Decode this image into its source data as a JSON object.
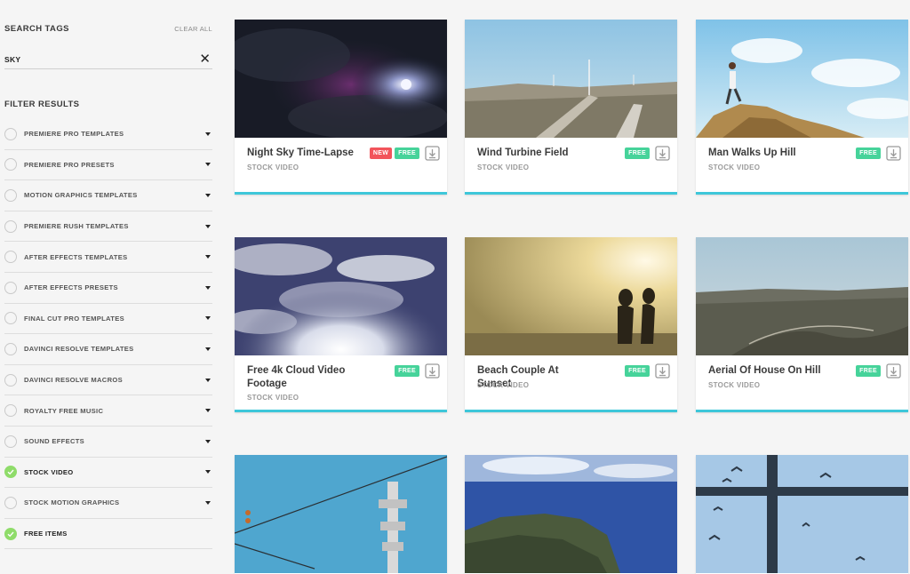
{
  "sidebar": {
    "search_title": "SEARCH TAGS",
    "clear_all": "CLEAR ALL",
    "tag": "SKY",
    "filter_title": "FILTER RESULTS",
    "filters": [
      {
        "label": "PREMIERE PRO TEMPLATES",
        "checked": false
      },
      {
        "label": "PREMIERE PRO PRESETS",
        "checked": false
      },
      {
        "label": "MOTION GRAPHICS TEMPLATES",
        "checked": false
      },
      {
        "label": "PREMIERE RUSH TEMPLATES",
        "checked": false
      },
      {
        "label": "AFTER EFFECTS TEMPLATES",
        "checked": false
      },
      {
        "label": "AFTER EFFECTS PRESETS",
        "checked": false
      },
      {
        "label": "FINAL CUT PRO TEMPLATES",
        "checked": false
      },
      {
        "label": "DAVINCI RESOLVE TEMPLATES",
        "checked": false
      },
      {
        "label": "DAVINCI RESOLVE MACROS",
        "checked": false
      },
      {
        "label": "ROYALTY FREE MUSIC",
        "checked": false
      },
      {
        "label": "SOUND EFFECTS",
        "checked": false
      },
      {
        "label": "STOCK VIDEO",
        "checked": true
      },
      {
        "label": "STOCK MOTION GRAPHICS",
        "checked": false
      },
      {
        "label": "FREE ITEMS",
        "checked": true
      }
    ]
  },
  "cards": [
    {
      "title": "Night Sky Time-Lapse",
      "category": "STOCK VIDEO",
      "badges": [
        "NEW",
        "FREE"
      ]
    },
    {
      "title": "Wind Turbine Field",
      "category": "STOCK VIDEO",
      "badges": [
        "FREE"
      ]
    },
    {
      "title": "Man Walks Up Hill",
      "category": "STOCK VIDEO",
      "badges": [
        "FREE"
      ]
    },
    {
      "title": "Free 4k Cloud Video Footage",
      "category": "STOCK VIDEO",
      "badges": [
        "FREE"
      ]
    },
    {
      "title": "Beach Couple At Sunset",
      "category": "STOCK VIDEO",
      "badges": [
        "FREE"
      ]
    },
    {
      "title": "Aerial Of House On Hill",
      "category": "STOCK VIDEO",
      "badges": [
        "FREE"
      ]
    }
  ],
  "colors": {
    "accent": "#3ec7d9",
    "badge_free": "#46d39a",
    "badge_new": "#f2545b",
    "check_green": "#8fdc6a"
  },
  "icons": {
    "close": "close-icon",
    "caret": "caret-down-icon",
    "download": "download-icon",
    "check": "check-icon"
  }
}
